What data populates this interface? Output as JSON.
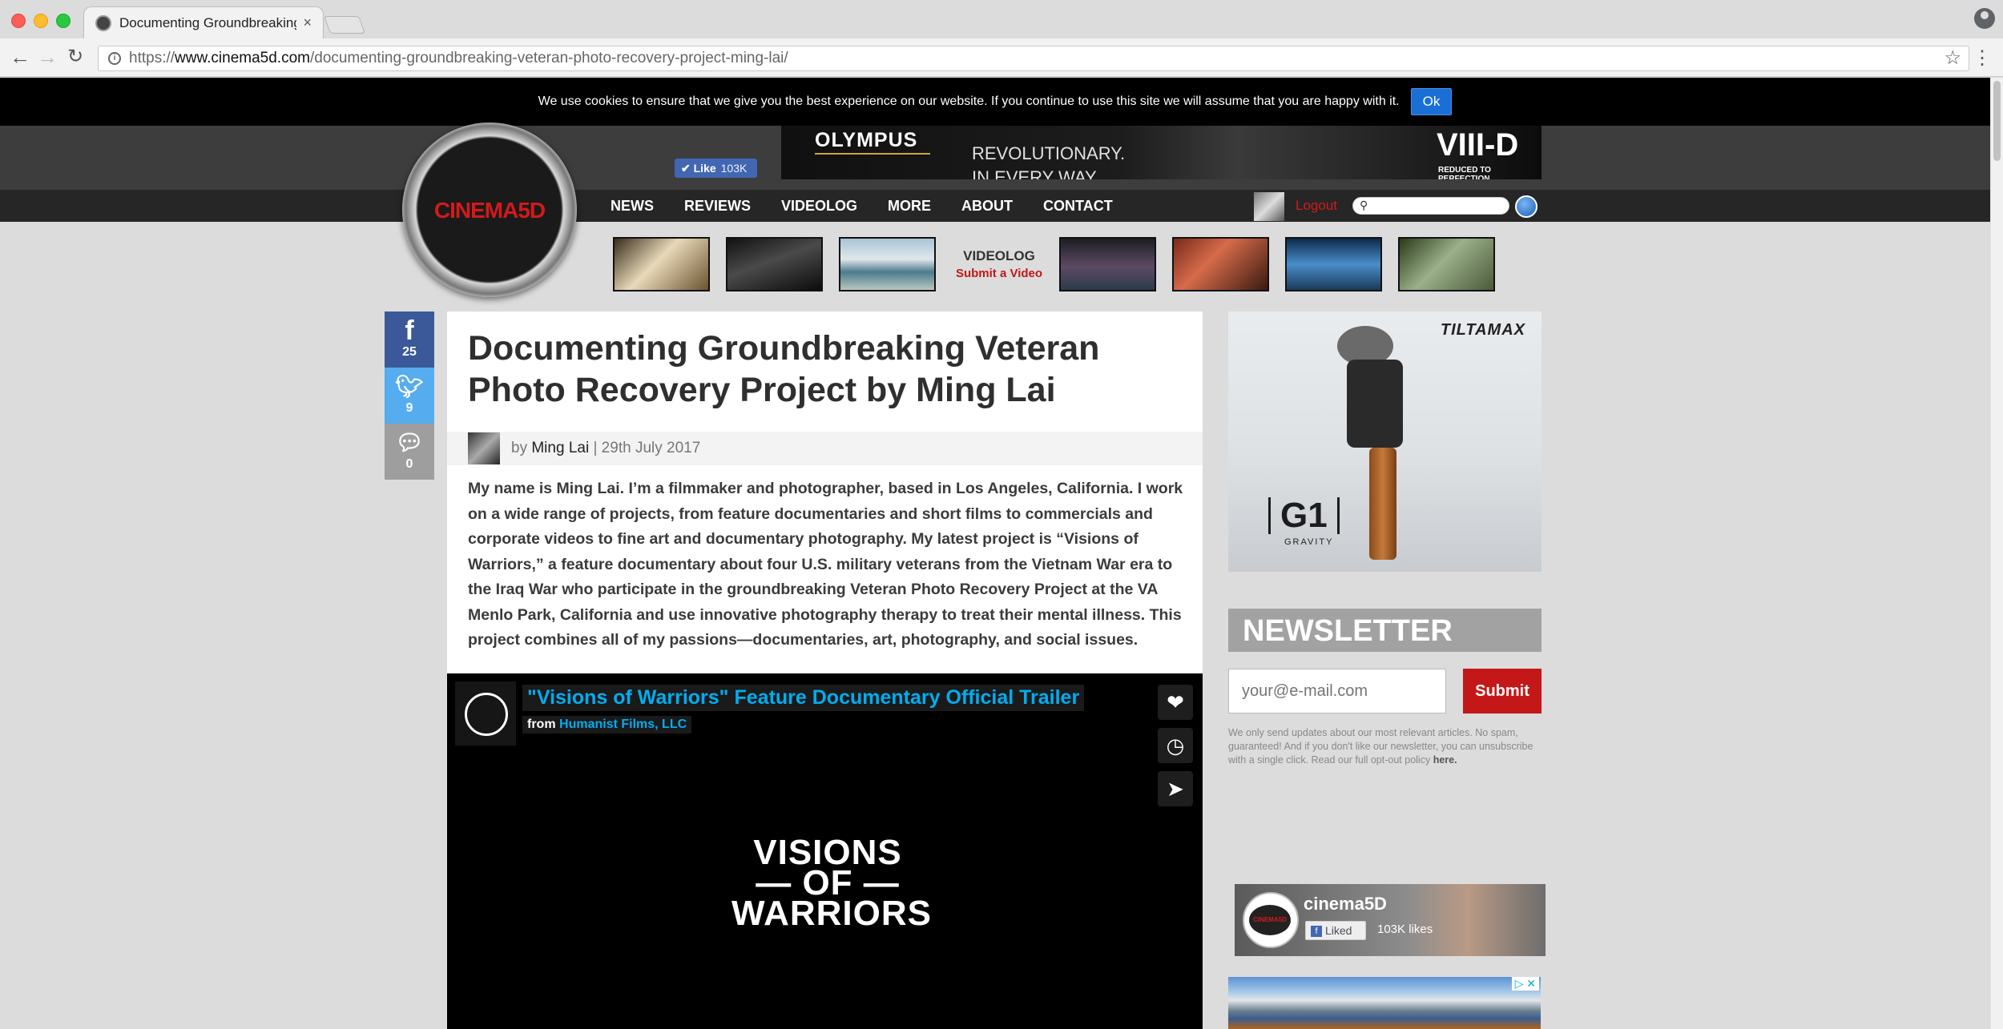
{
  "browser": {
    "tab_title": "Documenting Groundbreaking",
    "tab_close": "×",
    "url_prefix": "https://",
    "url_domain": "www.cinema5d.com",
    "url_path": "/documenting-groundbreaking-veteran-photo-recovery-project-ming-lai/"
  },
  "cookie": {
    "text": "We use cookies to ensure that we give you the best experience on our website. If you continue to use this site we will assume that you are happy with it.",
    "ok_label": "Ok"
  },
  "header": {
    "logo_text": "CINEMA5D",
    "fb_like_label": "Like",
    "fb_like_count": "103K",
    "ad": {
      "brand_left": "OLYMPUS",
      "tagline_1": "REVOLUTIONARY.",
      "tagline_2": "IN EVERY WAY.",
      "brand_right": "VIII-D",
      "brand_right_sub": "REDUCED TO PERFECTION"
    },
    "nav": [
      "NEWS",
      "REVIEWS",
      "VIDEOLOG",
      "MORE",
      "ABOUT",
      "CONTACT"
    ],
    "logout_label": "Logout",
    "videolog_title": "VIDEOLOG",
    "videolog_sub": "Submit a Video"
  },
  "share": {
    "facebook_count": "25",
    "twitter_count": "9",
    "comments_count": "0"
  },
  "article": {
    "title": "Documenting Groundbreaking Veteran Photo Recovery Project by Ming Lai",
    "by_prefix": "by",
    "author": "Ming Lai",
    "date": "| 29th July 2017",
    "body": "My name is Ming Lai. I’m a filmmaker and photographer, based in Los Angeles, California. I work on a wide range of projects, from feature documentaries and short films to commercials and corporate videos to fine art and documentary photography. My latest project is “Visions of Warriors,” a feature documentary about four U.S. military veterans from the Vietnam War era to the Iraq War who participate in the groundbreaking Veteran Photo Recovery Project at the VA Menlo Park, California and use innovative photography therapy to treat their mental illness. This project combines all of my passions—documentaries, art, photography, and social issues."
  },
  "video": {
    "title": "\"Visions of Warriors\" Feature Documentary Official Trailer",
    "from_prefix": "from",
    "from_name": "Humanist Films, LLC",
    "center_line1": "VISIONS",
    "center_line2": "— OF —",
    "center_line3": "WARRIORS"
  },
  "sidebar": {
    "ad_brand": "TILTAMAX",
    "ad_product": "G1",
    "ad_product_sub": "GRAVITY",
    "newsletter_title": "NEWSLETTER",
    "email_placeholder": "your@e-mail.com",
    "submit_label": "Submit",
    "note": "We only send updates about our most relevant articles. No spam, guaranteed! And if you don't like our newsletter, you can unsubscribe with a single click. Read our full opt-out policy",
    "note_link": "here.",
    "fb_page_name": "cinema5D",
    "fb_liked_label": "Liked",
    "fb_likes": "103K likes",
    "adchoice": "▷ ✕"
  },
  "colors": {
    "brand_red": "#d21a1a",
    "facebook": "#3b5998",
    "twitter": "#55acee",
    "vimeo_blue": "#00adef"
  }
}
